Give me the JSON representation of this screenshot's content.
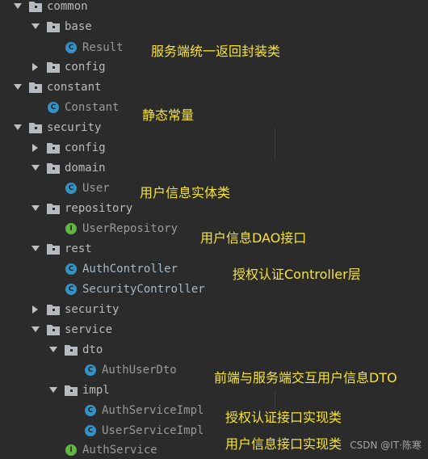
{
  "tree": {
    "common": "common",
    "base": "base",
    "result": "Result",
    "config1": "config",
    "constant_pkg": "constant",
    "constant_cls": "Constant",
    "security_pkg": "security",
    "config2": "config",
    "domain": "domain",
    "user": "User",
    "repository": "repository",
    "user_repository": "UserRepository",
    "rest": "rest",
    "auth_controller": "AuthController",
    "security_controller": "SecurityController",
    "security_sub": "security",
    "service": "service",
    "dto": "dto",
    "auth_user_dto": "AuthUserDto",
    "impl": "impl",
    "auth_service_impl": "AuthServiceImpl",
    "user_service_impl": "UserServiceImpl",
    "auth_service": "AuthService"
  },
  "badges": {
    "class": "C",
    "interface": "I"
  },
  "notes": {
    "result": "服务端统一返回封装类",
    "constant": "静态常量",
    "user": "用户信息实体类",
    "user_repository": "用户信息DAO接口",
    "controller": "授权认证Controller层",
    "dto": "前端与服务端交互用户信息DTO",
    "auth_impl": "授权认证接口实现类",
    "user_impl": "用户信息接口实现类"
  },
  "watermark": "CSDN @IT·陈寒",
  "colors": {
    "background": "#2b2b2b",
    "annotation": "#f6e33a",
    "class_icon": "#3592c4",
    "interface_icon": "#62b543"
  },
  "icons": {
    "expand": "chevron-down-icon",
    "collapse": "chevron-right-icon",
    "package": "folder-package-icon",
    "class": "class-icon",
    "interface": "interface-icon"
  }
}
